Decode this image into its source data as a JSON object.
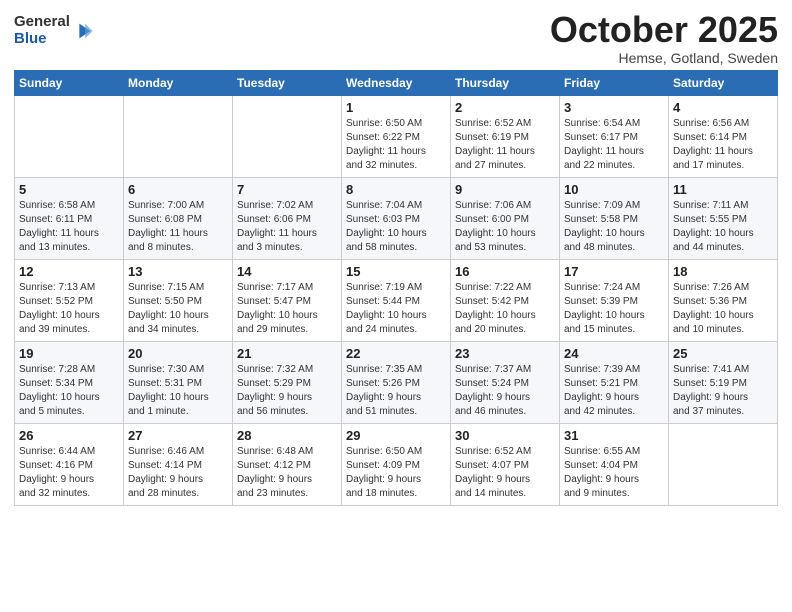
{
  "logo": {
    "general": "General",
    "blue": "Blue"
  },
  "header": {
    "month": "October 2025",
    "location": "Hemse, Gotland, Sweden"
  },
  "weekdays": [
    "Sunday",
    "Monday",
    "Tuesday",
    "Wednesday",
    "Thursday",
    "Friday",
    "Saturday"
  ],
  "weeks": [
    [
      {
        "day": "",
        "info": ""
      },
      {
        "day": "",
        "info": ""
      },
      {
        "day": "",
        "info": ""
      },
      {
        "day": "1",
        "info": "Sunrise: 6:50 AM\nSunset: 6:22 PM\nDaylight: 11 hours\nand 32 minutes."
      },
      {
        "day": "2",
        "info": "Sunrise: 6:52 AM\nSunset: 6:19 PM\nDaylight: 11 hours\nand 27 minutes."
      },
      {
        "day": "3",
        "info": "Sunrise: 6:54 AM\nSunset: 6:17 PM\nDaylight: 11 hours\nand 22 minutes."
      },
      {
        "day": "4",
        "info": "Sunrise: 6:56 AM\nSunset: 6:14 PM\nDaylight: 11 hours\nand 17 minutes."
      }
    ],
    [
      {
        "day": "5",
        "info": "Sunrise: 6:58 AM\nSunset: 6:11 PM\nDaylight: 11 hours\nand 13 minutes."
      },
      {
        "day": "6",
        "info": "Sunrise: 7:00 AM\nSunset: 6:08 PM\nDaylight: 11 hours\nand 8 minutes."
      },
      {
        "day": "7",
        "info": "Sunrise: 7:02 AM\nSunset: 6:06 PM\nDaylight: 11 hours\nand 3 minutes."
      },
      {
        "day": "8",
        "info": "Sunrise: 7:04 AM\nSunset: 6:03 PM\nDaylight: 10 hours\nand 58 minutes."
      },
      {
        "day": "9",
        "info": "Sunrise: 7:06 AM\nSunset: 6:00 PM\nDaylight: 10 hours\nand 53 minutes."
      },
      {
        "day": "10",
        "info": "Sunrise: 7:09 AM\nSunset: 5:58 PM\nDaylight: 10 hours\nand 48 minutes."
      },
      {
        "day": "11",
        "info": "Sunrise: 7:11 AM\nSunset: 5:55 PM\nDaylight: 10 hours\nand 44 minutes."
      }
    ],
    [
      {
        "day": "12",
        "info": "Sunrise: 7:13 AM\nSunset: 5:52 PM\nDaylight: 10 hours\nand 39 minutes."
      },
      {
        "day": "13",
        "info": "Sunrise: 7:15 AM\nSunset: 5:50 PM\nDaylight: 10 hours\nand 34 minutes."
      },
      {
        "day": "14",
        "info": "Sunrise: 7:17 AM\nSunset: 5:47 PM\nDaylight: 10 hours\nand 29 minutes."
      },
      {
        "day": "15",
        "info": "Sunrise: 7:19 AM\nSunset: 5:44 PM\nDaylight: 10 hours\nand 24 minutes."
      },
      {
        "day": "16",
        "info": "Sunrise: 7:22 AM\nSunset: 5:42 PM\nDaylight: 10 hours\nand 20 minutes."
      },
      {
        "day": "17",
        "info": "Sunrise: 7:24 AM\nSunset: 5:39 PM\nDaylight: 10 hours\nand 15 minutes."
      },
      {
        "day": "18",
        "info": "Sunrise: 7:26 AM\nSunset: 5:36 PM\nDaylight: 10 hours\nand 10 minutes."
      }
    ],
    [
      {
        "day": "19",
        "info": "Sunrise: 7:28 AM\nSunset: 5:34 PM\nDaylight: 10 hours\nand 5 minutes."
      },
      {
        "day": "20",
        "info": "Sunrise: 7:30 AM\nSunset: 5:31 PM\nDaylight: 10 hours\nand 1 minute."
      },
      {
        "day": "21",
        "info": "Sunrise: 7:32 AM\nSunset: 5:29 PM\nDaylight: 9 hours\nand 56 minutes."
      },
      {
        "day": "22",
        "info": "Sunrise: 7:35 AM\nSunset: 5:26 PM\nDaylight: 9 hours\nand 51 minutes."
      },
      {
        "day": "23",
        "info": "Sunrise: 7:37 AM\nSunset: 5:24 PM\nDaylight: 9 hours\nand 46 minutes."
      },
      {
        "day": "24",
        "info": "Sunrise: 7:39 AM\nSunset: 5:21 PM\nDaylight: 9 hours\nand 42 minutes."
      },
      {
        "day": "25",
        "info": "Sunrise: 7:41 AM\nSunset: 5:19 PM\nDaylight: 9 hours\nand 37 minutes."
      }
    ],
    [
      {
        "day": "26",
        "info": "Sunrise: 6:44 AM\nSunset: 4:16 PM\nDaylight: 9 hours\nand 32 minutes."
      },
      {
        "day": "27",
        "info": "Sunrise: 6:46 AM\nSunset: 4:14 PM\nDaylight: 9 hours\nand 28 minutes."
      },
      {
        "day": "28",
        "info": "Sunrise: 6:48 AM\nSunset: 4:12 PM\nDaylight: 9 hours\nand 23 minutes."
      },
      {
        "day": "29",
        "info": "Sunrise: 6:50 AM\nSunset: 4:09 PM\nDaylight: 9 hours\nand 18 minutes."
      },
      {
        "day": "30",
        "info": "Sunrise: 6:52 AM\nSunset: 4:07 PM\nDaylight: 9 hours\nand 14 minutes."
      },
      {
        "day": "31",
        "info": "Sunrise: 6:55 AM\nSunset: 4:04 PM\nDaylight: 9 hours\nand 9 minutes."
      },
      {
        "day": "",
        "info": ""
      }
    ]
  ]
}
